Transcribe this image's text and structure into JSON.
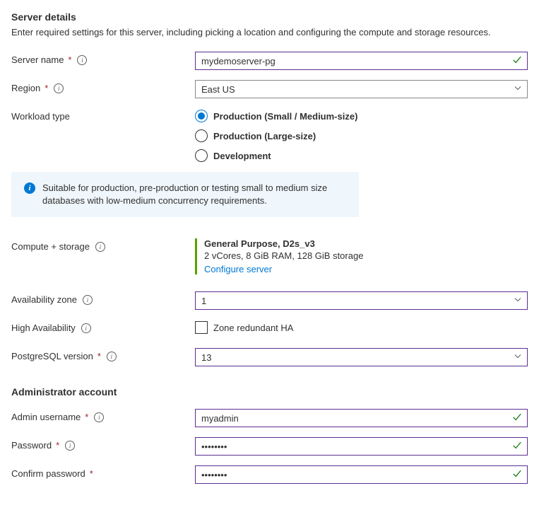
{
  "serverDetails": {
    "title": "Server details",
    "description": "Enter required settings for this server, including picking a location and configuring the compute and storage resources."
  },
  "fields": {
    "serverName": {
      "label": "Server name",
      "value": "mydemoserver-pg"
    },
    "region": {
      "label": "Region",
      "value": "East US"
    },
    "workloadType": {
      "label": "Workload type",
      "options": {
        "smallMedium": "Production (Small / Medium-size)",
        "large": "Production (Large-size)",
        "dev": "Development"
      },
      "selected": "smallMedium"
    },
    "infoBox": "Suitable for production, pre-production or testing small to medium size databases with low-medium concurrency requirements.",
    "computeStorage": {
      "label": "Compute + storage",
      "tier": "General Purpose, D2s_v3",
      "specs": "2 vCores, 8 GiB RAM, 128 GiB storage",
      "link": "Configure server"
    },
    "availabilityZone": {
      "label": "Availability zone",
      "value": "1"
    },
    "highAvailability": {
      "label": "High Availability",
      "checkboxLabel": "Zone redundant HA"
    },
    "postgresVersion": {
      "label": "PostgreSQL version",
      "value": "13"
    }
  },
  "adminAccount": {
    "title": "Administrator account",
    "username": {
      "label": "Admin username",
      "value": "myadmin"
    },
    "password": {
      "label": "Password",
      "value": "••••••••"
    },
    "confirmPassword": {
      "label": "Confirm password",
      "value": "••••••••"
    }
  }
}
